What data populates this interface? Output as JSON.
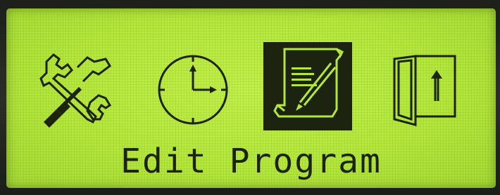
{
  "screen": {
    "caption": "Edit Program"
  },
  "menu": {
    "items": [
      {
        "icon": "tools-icon",
        "selected": false
      },
      {
        "icon": "clock-icon",
        "selected": false
      },
      {
        "icon": "edit-program-icon",
        "selected": true
      },
      {
        "icon": "exit-door-icon",
        "selected": false
      }
    ]
  },
  "colors": {
    "lcd_background": "#b4e83c",
    "pixel_ink": "#1c2410",
    "bezel": "#2a2d24"
  }
}
